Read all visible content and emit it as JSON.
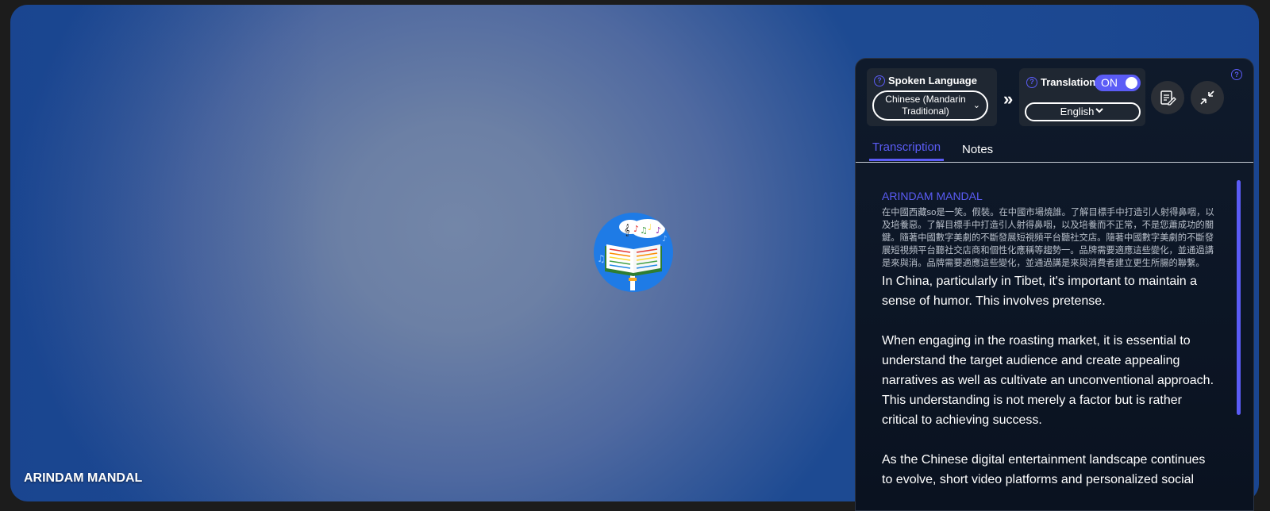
{
  "participant": {
    "name": "ARINDAM MANDAL"
  },
  "panel": {
    "spoken_language": {
      "title": "Spoken Language",
      "value_line1": "Chinese (Mandarin",
      "value_line2": "Traditional)"
    },
    "translation": {
      "title": "Translation",
      "toggle_label": "ON",
      "target_language": "English"
    },
    "tabs": [
      {
        "label": "Transcription",
        "active": true
      },
      {
        "label": "Notes",
        "active": false
      }
    ],
    "transcript": {
      "speaker": "ARINDAM MANDAL",
      "original": "在中國西藏so是一笑。假裝。在中國市場燒誰。了解目標手中打造引人射得鼻咽，以及培養惡。了解目標手中打造引人射得鼻咽，以及培養而不正常，不是您蕭成功的關鍵。隨著中國數字美劇的不斷發展短視頻平台聽社交店。隨著中國數字美劇的不斷發展短視頻平台聽社交店商和個性化應稱等趨勢一。品牌需要適應這些變化，並通過講是來與消。品牌需要適應這些變化，並通過講是來與消費者建立更生所腸的聯繫。",
      "paragraphs": [
        "In China, particularly in Tibet, it's important to maintain a sense of humor. This involves pretense.",
        "When engaging in the roasting market, it is essential to understand the target audience and create appealing narratives as well as cultivate an unconventional approach. This understanding is not merely a factor but is rather critical to achieving success.",
        "As the Chinese digital entertainment landscape continues to evolve, short video platforms and personalized social"
      ]
    }
  },
  "colors": {
    "accent": "#5b5cf6",
    "panel_bg": "#0f1a2b",
    "stage_blue": "#1d4a92"
  }
}
